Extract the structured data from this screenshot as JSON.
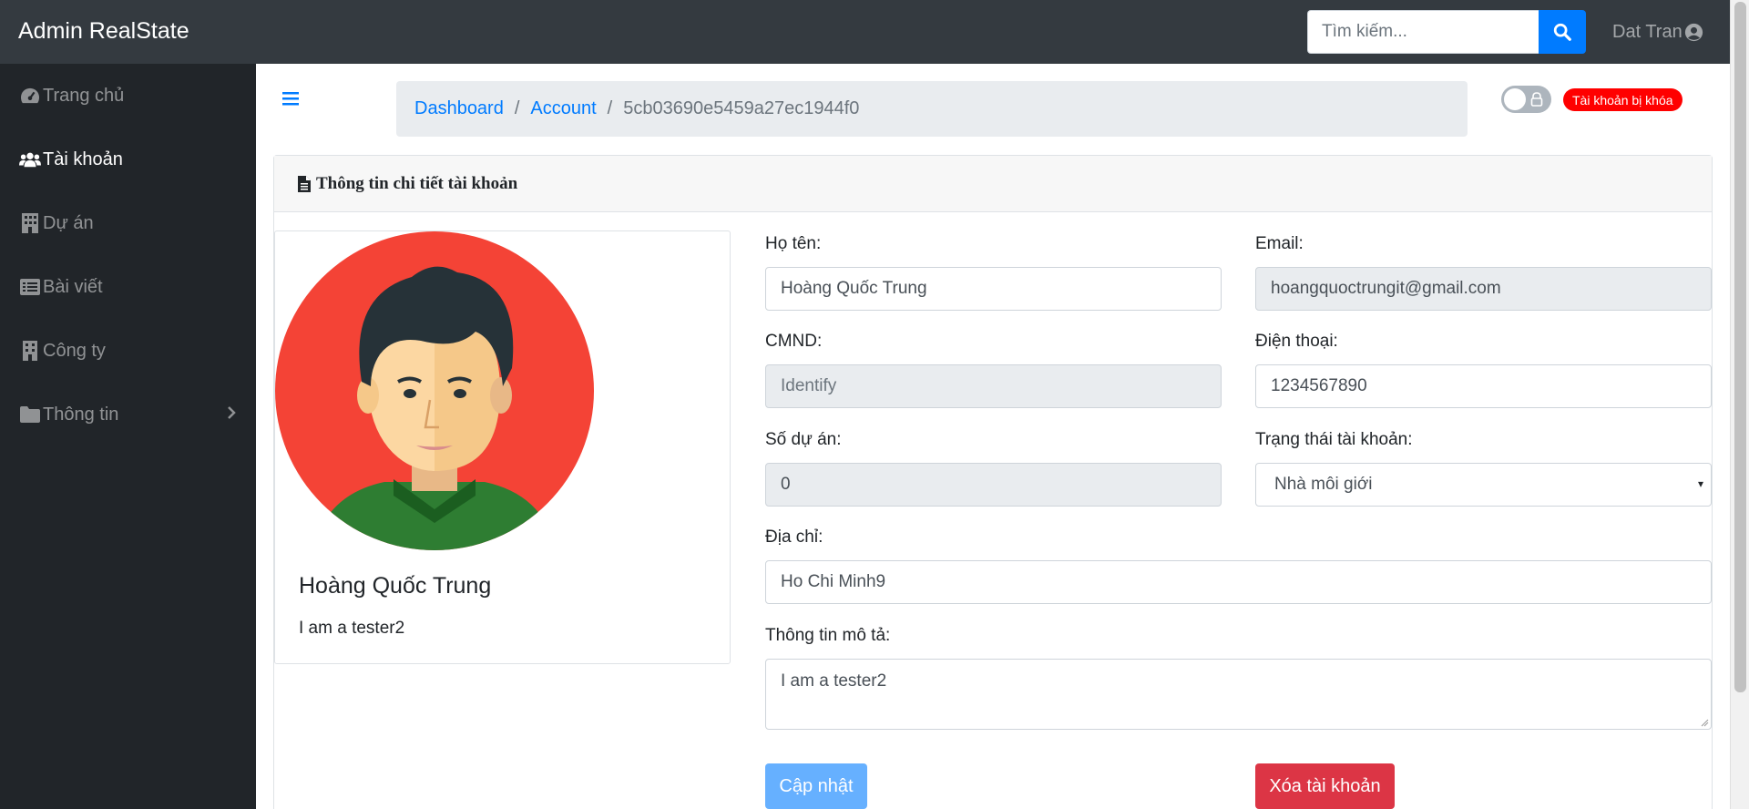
{
  "app": {
    "brand": "Admin RealState"
  },
  "search": {
    "placeholder": "Tìm kiếm...",
    "icon": "search-icon"
  },
  "user": {
    "name": "Dat Tran",
    "icon": "user-circle-icon"
  },
  "sidebar": {
    "items": [
      {
        "label": "Trang chủ",
        "icon": "tachometer-icon"
      },
      {
        "label": "Tài khoản",
        "icon": "users-icon",
        "active": true
      },
      {
        "label": "Dự án",
        "icon": "building-icon"
      },
      {
        "label": "Bài viết",
        "icon": "list-alt-icon"
      },
      {
        "label": "Công ty",
        "icon": "building-icon"
      },
      {
        "label": "Thông tin",
        "icon": "folder-icon",
        "has_children": true
      }
    ]
  },
  "breadcrumb": {
    "items": [
      "Dashboard",
      "Account"
    ],
    "current": "5cb03690e5459a27ec1944f0"
  },
  "status": {
    "locked_badge": "Tài khoản bị khóa",
    "toggle_on": false
  },
  "card": {
    "title": "Thông tin chi tiết tài khoản",
    "icon": "file-text-icon"
  },
  "profile": {
    "name": "Hoàng Quốc Trung",
    "bio": "I am a tester2"
  },
  "form": {
    "name": {
      "label": "Họ tên:",
      "value": "Hoàng Quốc Trung"
    },
    "email": {
      "label": "Email:",
      "value": "hoangquoctrungit@gmail.com"
    },
    "cmnd": {
      "label": "CMND:",
      "placeholder": "Identify"
    },
    "phone": {
      "label": "Điện thoại:",
      "value": "1234567890"
    },
    "projects": {
      "label": "Số dự án:",
      "value": "0"
    },
    "status": {
      "label": "Trạng thái tài khoản:",
      "value": "Nhà môi giới"
    },
    "address": {
      "label": "Địa chỉ:",
      "value": "Ho Chi Minh9"
    },
    "description": {
      "label": "Thông tin mô tả:",
      "value": "I am a tester2"
    }
  },
  "buttons": {
    "update": "Cập nhật",
    "delete": "Xóa tài khoản"
  },
  "colors": {
    "navbar": "#343a40",
    "sidebar": "#212529",
    "primary": "#007bff",
    "danger": "#dc3545",
    "badge": "#ff0000"
  }
}
